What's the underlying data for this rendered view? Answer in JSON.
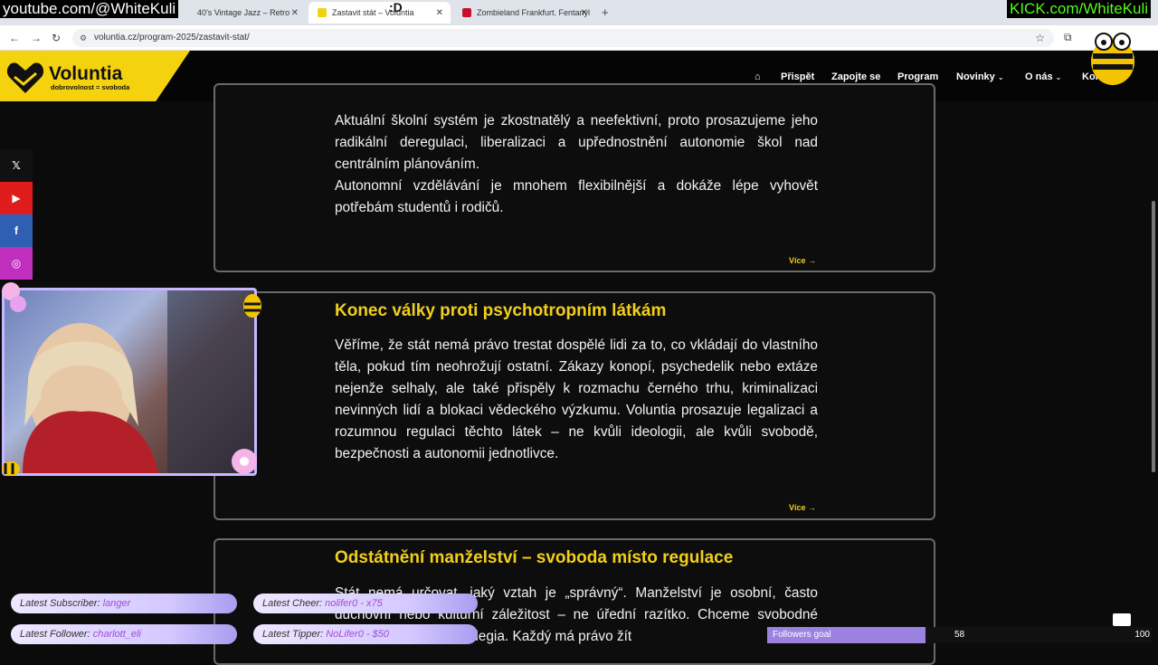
{
  "browser": {
    "tabs": [
      {
        "title": "40's Vintage Jazz – Retro",
        "active": false
      },
      {
        "title": "Zastavit stát – Voluntia",
        "active": true
      },
      {
        "title": "Zombieland Frankfurt. Fentanyl",
        "active": false
      }
    ],
    "url": "voluntia.cz/program-2025/zastavit-stat/"
  },
  "site": {
    "logo": {
      "name": "Voluntia",
      "tagline": "dobrovolnost = svoboda"
    },
    "nav": [
      "⌂",
      "Přispět",
      "Zapojte se",
      "Program",
      "Novinky",
      "O nás",
      "Kontakt"
    ]
  },
  "cards": [
    {
      "title": "",
      "text": "Aktuální školní systém je zkostnatělý a neefektivní, proto prosazujeme jeho radikální deregulaci, liberalizaci a upřednostnění autonomie škol nad centrálním plánováním.",
      "text2": "Autonomní vzdělávání je mnohem flexibilnější a dokáže lépe vyhovět potřebám studentů i rodičů.",
      "more": "Více →"
    },
    {
      "title": "Konec války proti psychotropním látkám",
      "text": "Věříme, že stát nemá právo trestat dospělé lidi za to, co vkládají do vlastního těla, pokud tím neohrožují ostatní. Zákazy konopí, psychedelik nebo extáze nejenže selhaly, ale také přispěly k rozmachu černého trhu, kriminalizaci nevinných lidí a blokaci vědeckého výzkumu. Voluntia prosazuje legalizaci a rozumnou regulaci těchto látek – ne kvůli ideologii, ale kvůli svobodě, bezpečnosti a autonomii jednotlivce.",
      "more": "Více →"
    },
    {
      "title": "Odstátnění manželství – svoboda místo regulace",
      "text": "Stát nemá určovat, jaký vztah je „správný“. Manželství je osobní, často duchovní nebo kulturní záležitost – ne úřední razítko. Chceme svobodné smlouvy, ne státní privilegia. Každý má právo žít"
    }
  ],
  "overlay": {
    "watermark_left": "youtube.com/@WhiteKuli",
    "watermark_right": "KICK.com/WhiteKuli",
    "tab_marker": ":D",
    "latest_subscriber": {
      "label": "Latest Subscriber:",
      "value": "langer"
    },
    "latest_cheer": {
      "label": "Latest Cheer:",
      "value": "nolifer0 - x75"
    },
    "latest_follower": {
      "label": "Latest Follower:",
      "value": "charlott_eli"
    },
    "latest_tipper": {
      "label": "Latest Tipper:",
      "value": "NoLifer0 - $50"
    },
    "followers_goal": {
      "label": "Followers goal",
      "current": 58,
      "target": 100
    }
  },
  "colors": {
    "accent": "#f2cf1b",
    "background": "#0b0b0b",
    "card_border": "#6a6a6a",
    "goal_fill": "#9b82e0"
  }
}
